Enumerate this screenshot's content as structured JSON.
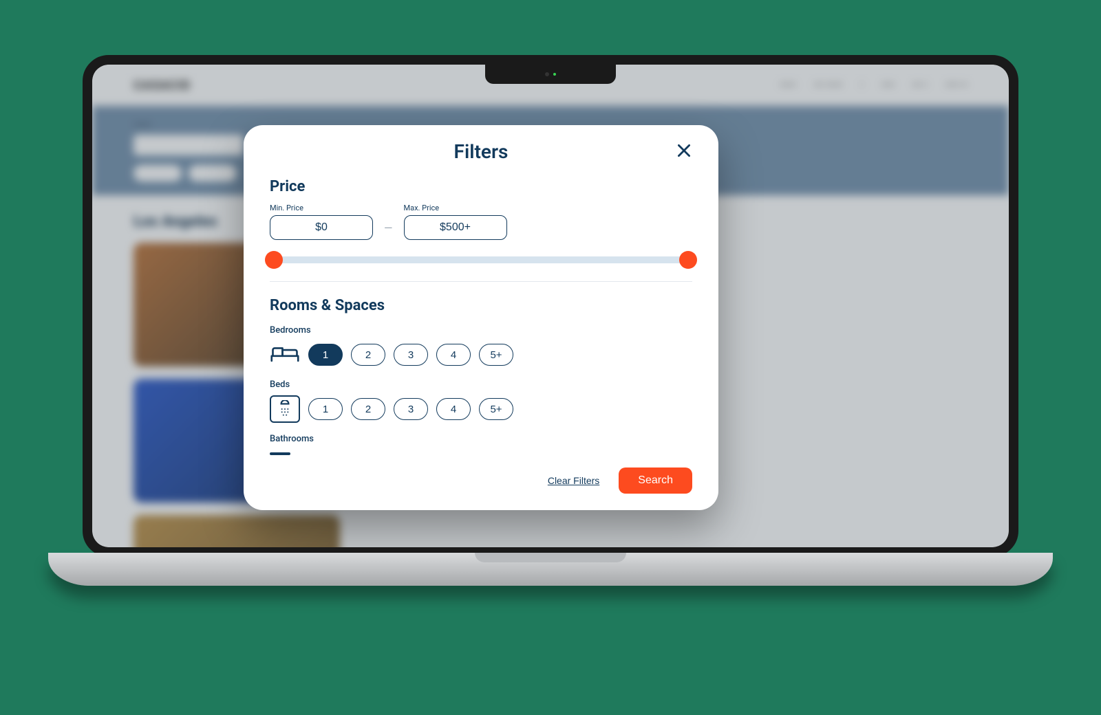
{
  "modal": {
    "title": "Filters",
    "price": {
      "section_label": "Price",
      "min_label": "Min. Price",
      "max_label": "Max. Price",
      "min_value": "$0",
      "max_value": "$500+",
      "slider_min_pct": 0,
      "slider_max_pct": 100
    },
    "rooms": {
      "section_label": "Rooms & Spaces",
      "bedrooms": {
        "label": "Bedrooms",
        "options": [
          "1",
          "2",
          "3",
          "4",
          "5+"
        ],
        "selected_index": 0
      },
      "beds": {
        "label": "Beds",
        "options": [
          "1",
          "2",
          "3",
          "4",
          "5+"
        ],
        "selected_index": -1
      },
      "bathrooms": {
        "label": "Bathrooms"
      }
    },
    "footer": {
      "clear": "Clear Filters",
      "search": "Search"
    }
  },
  "background": {
    "brand": "CASACID",
    "heading": "Los Angeles"
  },
  "colors": {
    "accent": "#fd4b1f",
    "ink": "#123a5c"
  }
}
